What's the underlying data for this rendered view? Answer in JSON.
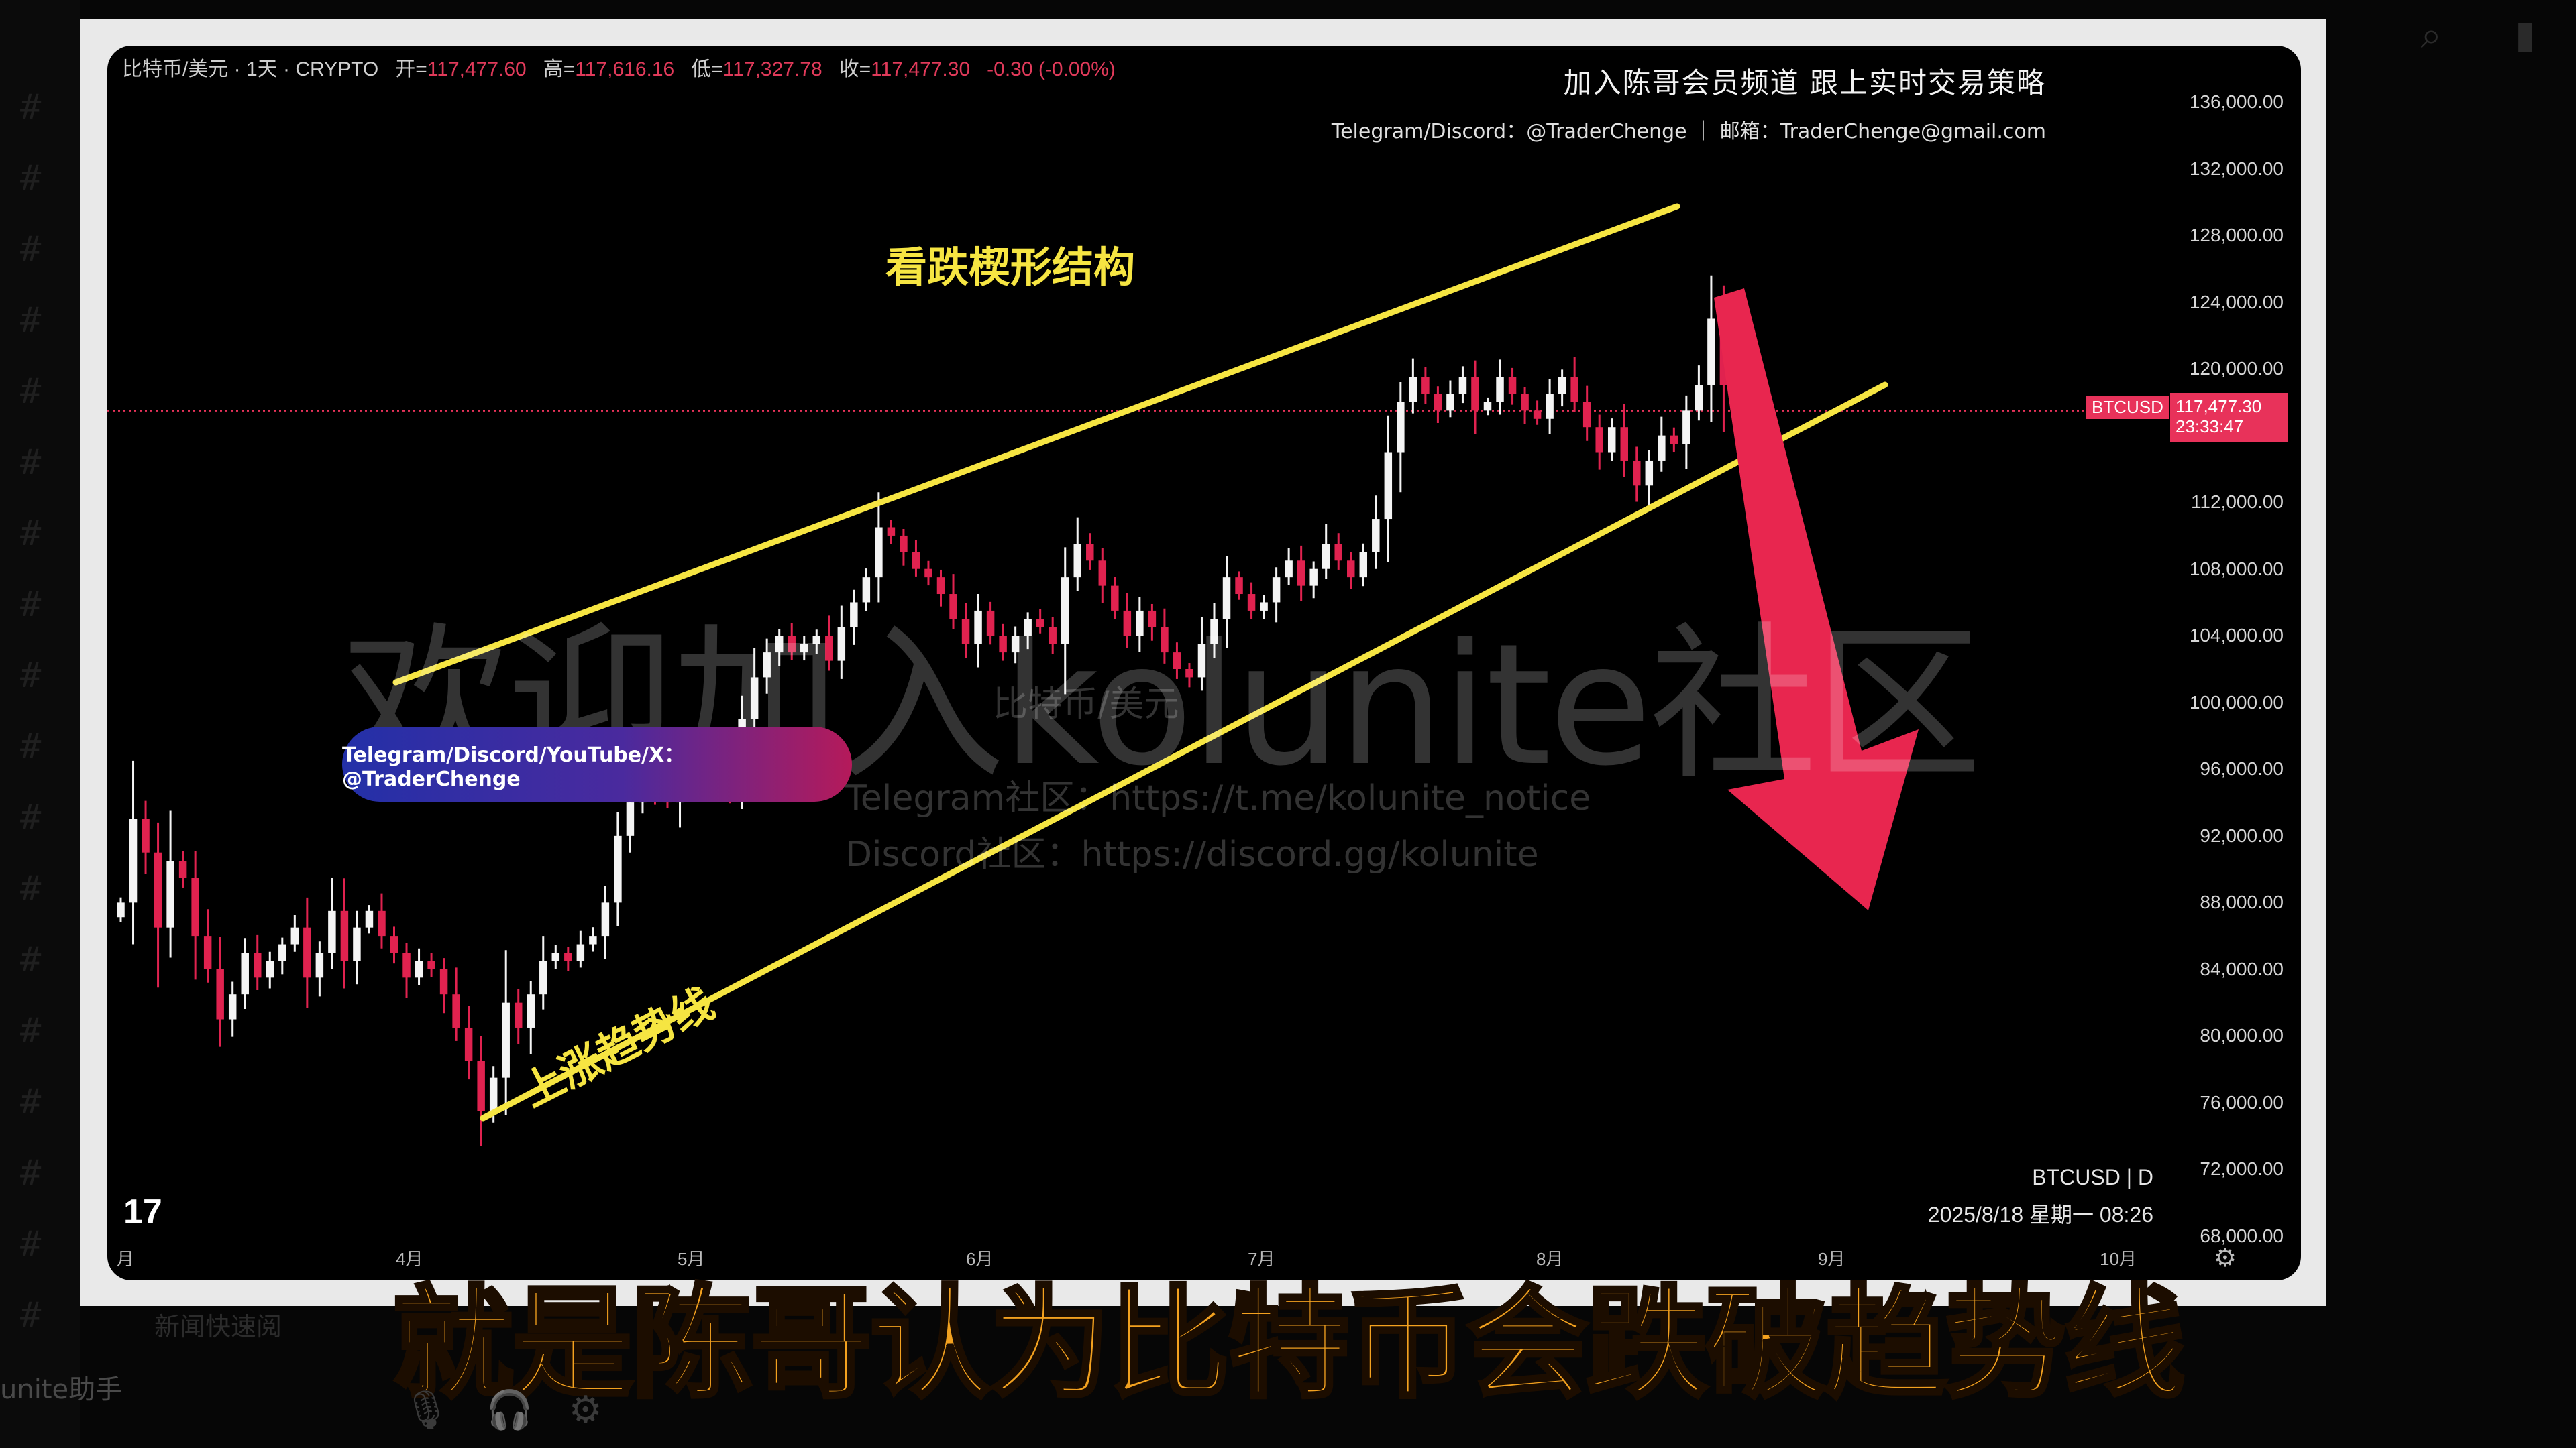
{
  "colors": {
    "bull": "#f4f4f4",
    "bear": "#e0224f",
    "trendline": "#f6e542",
    "arrow": "#e8264f",
    "price_line": "#e8325a",
    "caption": "#f3a11f"
  },
  "header": {
    "symbol": "比特币/美元 · 1天 · CRYPTO",
    "open_label": "开=",
    "open": "117,477.60",
    "high_label": "高=",
    "high": "117,616.16",
    "low_label": "低=",
    "low": "117,327.78",
    "close_label": "收=",
    "close": "117,477.30",
    "change": "-0.30 (-0.00%)"
  },
  "promo": {
    "line1": "加入陈哥会员频道 跟上实时交易策略",
    "line2": "Telegram/Discord：@TraderChenge ｜ 邮箱：TraderChenge@gmail.com"
  },
  "price_tag": {
    "symbol": "BTCUSD",
    "price": "117,477.30",
    "countdown": "23:33:47"
  },
  "pill_text": "Telegram/Discord/YouTube/X：@TraderChenge",
  "watermark": {
    "big": "欢迎加入kolunite社区",
    "small": "比特币/美元",
    "telegram": "Telegram社区：https://t.me/kolunite_notice",
    "discord": "Discord社区：https://discord.gg/kolunite"
  },
  "annotations": {
    "wedge": "看跌楔形结构",
    "uptrend": "上涨趋势线"
  },
  "tv_logo": "17",
  "symbol_info": {
    "line1": "BTCUSD | D",
    "line2": "2025/8/18 星期一 08:26"
  },
  "xaxis": [
    "月",
    "4月",
    "5月",
    "6月",
    "7月",
    "8月",
    "9月",
    "10月"
  ],
  "caption": "就是陈哥认为比特币会跌破趋势线",
  "bottom": {
    "helper": "unite助手",
    "faded": "新闻快速阅"
  },
  "icons": {
    "mic": "microphone-icon",
    "headset": "headset-icon",
    "gear": "gear-icon",
    "search": "search-icon",
    "bookmark": "bookmark-icon",
    "settings_axis": "gear-icon"
  },
  "chart_data": {
    "type": "candlestick",
    "title": "比特币/美元 · 1天 · CRYPTO",
    "ylabel": "",
    "ylim": [
      66000,
      138000
    ],
    "yticks": [
      136000,
      132000,
      128000,
      124000,
      120000,
      116000,
      112000,
      108000,
      104000,
      100000,
      96000,
      92000,
      88000,
      84000,
      80000,
      76000,
      72000,
      68000
    ],
    "ytick_labels": [
      "136,000.00",
      "132,000.00",
      "128,000.00",
      "124,000.00",
      "120,000.00",
      "",
      "112,000.00",
      "108,000.00",
      "104,000.00",
      "100,000.00",
      "96,000.00",
      "92,000.00",
      "88,000.00",
      "84,000.00",
      "80,000.00",
      "76,000.00",
      "72,000.00",
      "68,000.00"
    ],
    "last_price": 117477.3,
    "closes": [
      88000,
      93000,
      91000,
      86500,
      90500,
      89500,
      86000,
      84000,
      81000,
      82500,
      85000,
      83500,
      84500,
      85500,
      86500,
      83500,
      85000,
      87500,
      84500,
      86500,
      87500,
      86000,
      85000,
      83500,
      84500,
      84000,
      82500,
      80500,
      78500,
      75500,
      77500,
      82000,
      80500,
      82500,
      84500,
      85000,
      84500,
      85500,
      86000,
      88000,
      92000,
      94000,
      95000,
      94500,
      94000,
      96500,
      95500,
      97000,
      96500,
      95000,
      99000,
      101500,
      103000,
      104000,
      103000,
      103500,
      104000,
      102500,
      104500,
      106000,
      107500,
      110500,
      110000,
      109000,
      108000,
      107500,
      106500,
      105000,
      103500,
      105500,
      104000,
      103000,
      104000,
      105000,
      104500,
      103500,
      107500,
      109500,
      108500,
      107000,
      105500,
      104000,
      105500,
      104500,
      103000,
      102000,
      101500,
      103500,
      105000,
      107500,
      106500,
      105500,
      106000,
      107500,
      108500,
      107000,
      108000,
      109500,
      108500,
      107500,
      109000,
      111000,
      115000,
      118000,
      119500,
      118500,
      117500,
      118500,
      119500,
      117500,
      118000,
      119500,
      118500,
      117500,
      117000,
      118500,
      119500,
      118000,
      116500,
      115000,
      116500,
      114500,
      113000,
      114500,
      116000,
      115500,
      117500,
      119000,
      123000,
      119000,
      118000,
      117500,
      117477
    ]
  }
}
